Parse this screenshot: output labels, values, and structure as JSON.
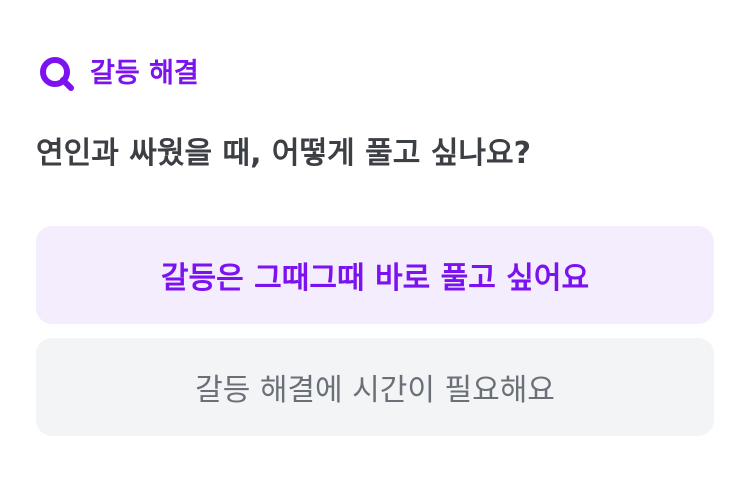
{
  "category": {
    "label": "갈등 해결",
    "icon": "search-q-icon",
    "color": "#7c12f0"
  },
  "question": {
    "text": "연인과 싸웠을 때, 어떻게 풀고 싶나요?"
  },
  "options": [
    {
      "label": "갈등은 그때그때 바로 풀고 싶어요",
      "selected": true
    },
    {
      "label": "갈등 해결에 시간이 필요해요",
      "selected": false
    }
  ],
  "colors": {
    "accent": "#7c12f0",
    "selected_bg": "#f4edfe",
    "default_bg": "#f2f4f6",
    "question_text": "#3c3f44",
    "option_text": "#6b7078"
  }
}
